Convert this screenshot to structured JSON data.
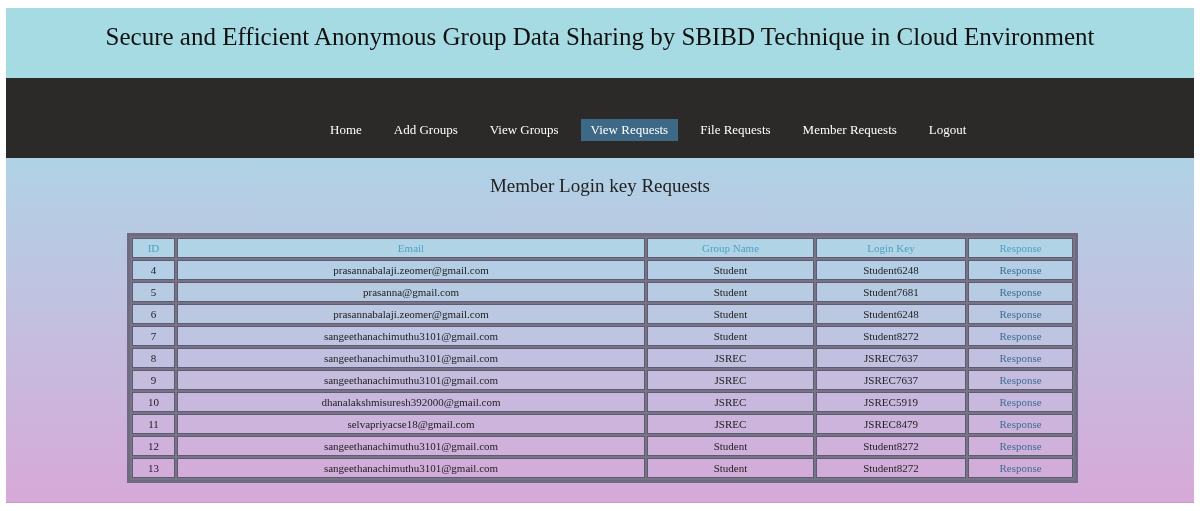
{
  "header": {
    "title": "Secure and Efficient Anonymous Group Data Sharing by SBIBD Technique in Cloud Environment"
  },
  "nav": [
    {
      "label": "Home",
      "selected": false
    },
    {
      "label": "Add Groups",
      "selected": false
    },
    {
      "label": "View Groups",
      "selected": false
    },
    {
      "label": "View Requests",
      "selected": true
    },
    {
      "label": "File Requests",
      "selected": false
    },
    {
      "label": "Member Requests",
      "selected": false
    },
    {
      "label": "Logout",
      "selected": false
    }
  ],
  "page": {
    "heading": "Member Login key Requests"
  },
  "table": {
    "columns": [
      "ID",
      "Email",
      "Group Name",
      "Login Key",
      "Response"
    ],
    "rows": [
      [
        "4",
        "prasannabalaji.zeomer@gmail.com",
        "Student",
        "Student6248",
        "Response"
      ],
      [
        "5",
        "prasanna@gmail.com",
        "Student",
        "Student7681",
        "Response"
      ],
      [
        "6",
        "prasannabalaji.zeomer@gmail.com",
        "Student",
        "Student6248",
        "Response"
      ],
      [
        "7",
        "sangeethanachimuthu3101@gmail.com",
        "Student",
        "Student8272",
        "Response"
      ],
      [
        "8",
        "sangeethanachimuthu3101@gmail.com",
        "JSREC",
        "JSREC7637",
        "Response"
      ],
      [
        "9",
        "sangeethanachimuthu3101@gmail.com",
        "JSREC",
        "JSREC7637",
        "Response"
      ],
      [
        "10",
        "dhanalakshmisuresh392000@gmail.com",
        "JSREC",
        "JSREC5919",
        "Response"
      ],
      [
        "11",
        "selvapriyacse18@gmail.com",
        "JSREC",
        "JSREC8479",
        "Response"
      ],
      [
        "12",
        "sangeethanachimuthu3101@gmail.com",
        "Student",
        "Student8272",
        "Response"
      ],
      [
        "13",
        "sangeethanachimuthu3101@gmail.com",
        "Student",
        "Student8272",
        "Response"
      ]
    ]
  }
}
